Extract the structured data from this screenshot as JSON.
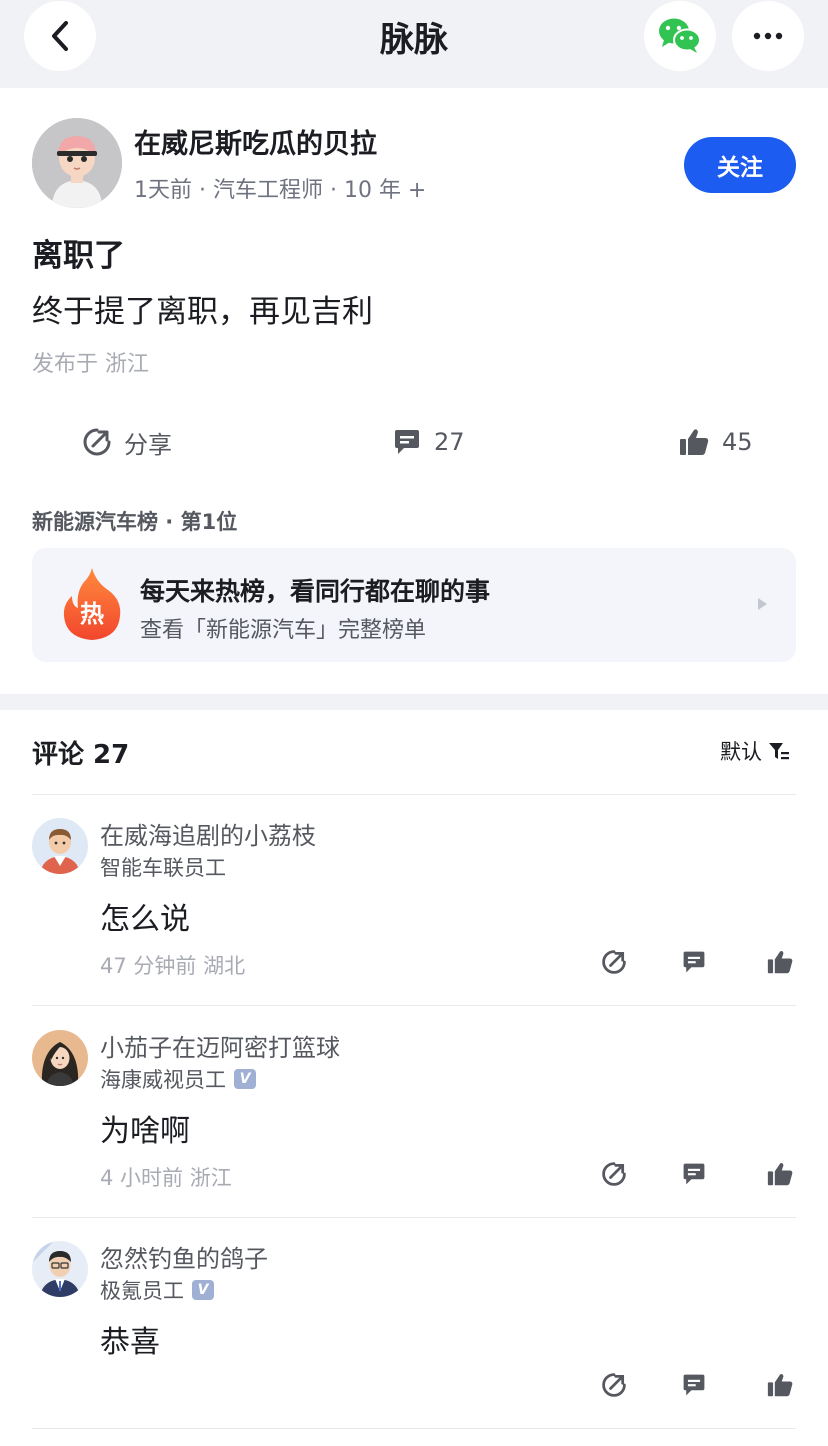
{
  "app": {
    "title": "脉脉"
  },
  "post": {
    "author_name": "在威尼斯吃瓜的贝拉",
    "author_meta": "1天前 · 汽车工程师 · 10 年 +",
    "follow_label": "关注",
    "title": "离职了",
    "body": "终于提了离职，再见吉利",
    "location": "发布于 浙江",
    "actions": {
      "share_label": "分享",
      "comment_count": "27",
      "like_count": "45"
    }
  },
  "hot": {
    "rank_label": "新能源汽车榜 · 第1位",
    "flame_text": "热",
    "title": "每天来热榜，看同行都在聊的事",
    "subtitle": "查看「新能源汽车」完整榜单"
  },
  "comments_section": {
    "header": "评论 27",
    "sort_label": "默认",
    "items": [
      {
        "name": "在威海追剧的小荔枝",
        "company": "智能车联员工",
        "verified": false,
        "text": "怎么说",
        "meta": "47 分钟前  湖北"
      },
      {
        "name": "小茄子在迈阿密打篮球",
        "company": "海康威视员工",
        "verified": true,
        "text": "为啥啊",
        "meta": "4 小时前  浙江"
      },
      {
        "name": "忽然钓鱼的鸽子",
        "company": "极氪员工",
        "verified": true,
        "text": "恭喜",
        "meta": ""
      }
    ],
    "verified_badge": "V"
  },
  "colors": {
    "accent": "#1c5cf1",
    "background_bar": "#f1f2f6",
    "card": "#f3f5fb",
    "wechat": "#31c452",
    "flame": "#f2612f"
  },
  "icons": [
    "back-icon",
    "wechat-icon",
    "more-icon",
    "share-icon",
    "comment-icon",
    "like-icon",
    "flame-icon",
    "chevron-right-icon",
    "filter-icon"
  ]
}
